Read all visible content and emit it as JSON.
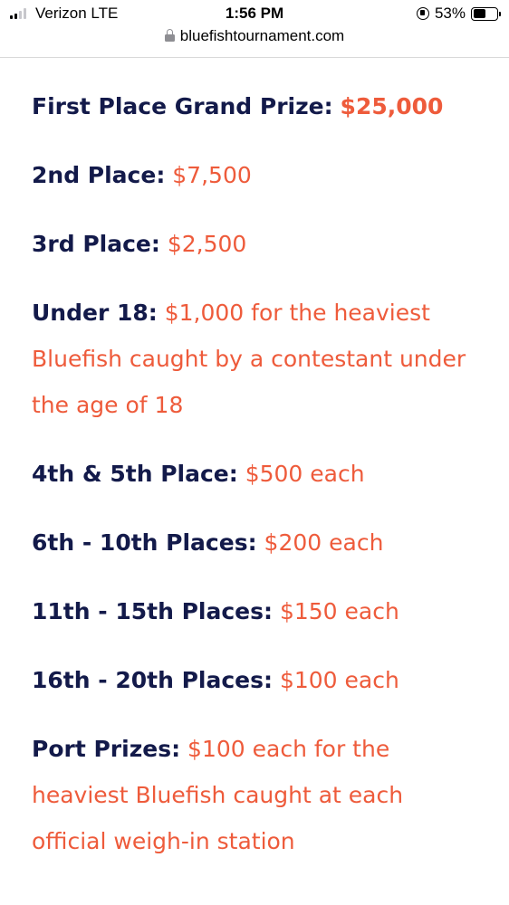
{
  "status_bar": {
    "carrier": "Verizon  LTE",
    "time": "1:56 PM",
    "battery": "53%",
    "battery_level": 0.53,
    "signal_bars_filled": 2,
    "signal_bars_total": 4
  },
  "browser": {
    "url": "bluefishtournament.com"
  },
  "colors": {
    "label": "#131a4a",
    "value": "#ee5b3b"
  },
  "prizes": [
    {
      "label": "First Place Grand Prize:",
      "value": "$25,000"
    },
    {
      "label": "2nd Place:",
      "value": "$7,500"
    },
    {
      "label": "3rd Place:",
      "value": "$2,500"
    },
    {
      "label": "Under 18:",
      "value": "$1,000 for the heaviest Bluefish caught by a contestant under the age of 18"
    },
    {
      "label": "4th & 5th Place:",
      "value": "$500 each"
    },
    {
      "label": "6th - 10th Places:",
      "value": "$200 each"
    },
    {
      "label": "11th - 15th Places:",
      "value": "$150 each"
    },
    {
      "label": "16th - 20th Places:",
      "value": "$100 each"
    },
    {
      "label": "Port Prizes:",
      "value": "$100 each for the heaviest Bluefish caught at each official weigh-in station"
    }
  ]
}
